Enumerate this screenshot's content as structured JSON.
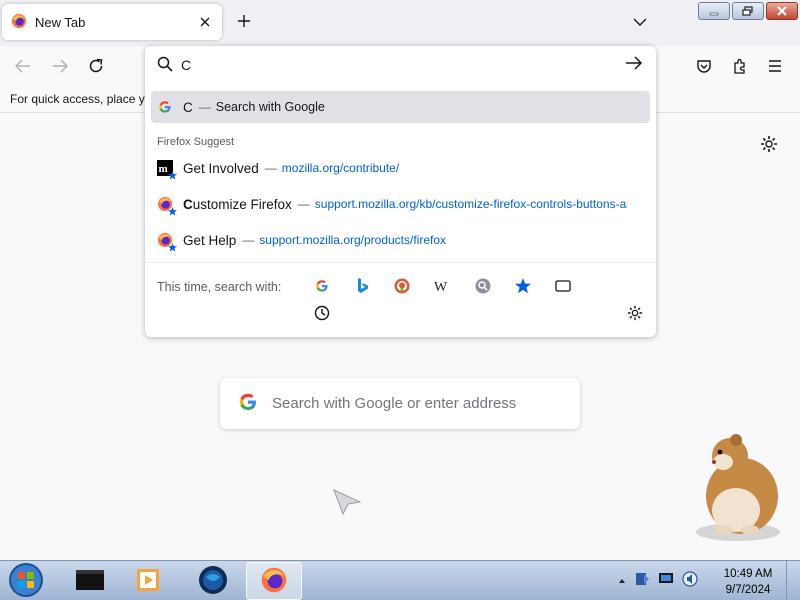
{
  "browser": {
    "tab": {
      "title": "New Tab",
      "icon": "firefox-logo-icon",
      "close_icon": "close-icon"
    },
    "new_tab_icon": "plus-icon",
    "list_all_tabs_icon": "chevron-down-icon",
    "window_controls": [
      "minimize-icon",
      "restore-icon",
      "close-icon"
    ]
  },
  "navbar": {
    "back_icon": "back-arrow-icon",
    "forward_icon": "forward-arrow-icon",
    "reload_icon": "reload-icon",
    "right_icons": [
      "pocket-icon",
      "extensions-icon",
      "menu-icon"
    ]
  },
  "bookmarks_bar": {
    "text": "For quick access, place yo"
  },
  "urlbar": {
    "value": "C",
    "go_icon": "arrow-right-icon",
    "search_row": {
      "title": "C",
      "separator": "—",
      "action": "Search with Google"
    },
    "suggest_header": "Firefox Suggest",
    "suggestions": [
      {
        "title": "Get Involved",
        "separator": "—",
        "url": "mozilla.org/contribute/",
        "icon": "mozilla-logo-icon"
      },
      {
        "title_bold": "C",
        "title_rest": "ustomize Firefox",
        "separator": "—",
        "url": "support.mozilla.org/kb/customize-firefox-controls-buttons-a",
        "icon": "firefox-bookmark-icon"
      },
      {
        "title": "Get Help",
        "separator": "—",
        "url": "support.mozilla.org/products/firefox",
        "icon": "firefox-bookmark-icon"
      }
    ],
    "oneoff_label": "This time, search with:",
    "oneoff_icons": [
      "google-icon",
      "bing-icon",
      "duckduckgo-icon",
      "wikipedia-icon",
      "search-engine-icon",
      "bookmarks-star-icon",
      "tabs-icon",
      "history-icon"
    ],
    "settings_icon": "gear-icon"
  },
  "page": {
    "search_placeholder": "Search with Google or enter address",
    "settings_icon": "gear-icon"
  },
  "taskbar": {
    "apps": [
      "start-orb-icon",
      "terminal-icon",
      "media-player-icon",
      "network-globe-icon",
      "firefox-icon"
    ],
    "tray_icons": [
      "show-hidden-icon",
      "action-center-icon",
      "network-icon",
      "volume-icon"
    ],
    "time": "10:49 AM",
    "date": "9/7/2024"
  },
  "colors": {
    "accent": "#0061e0",
    "selected_row": "#e0e0e6",
    "taskbar": "#b4c6e0"
  }
}
